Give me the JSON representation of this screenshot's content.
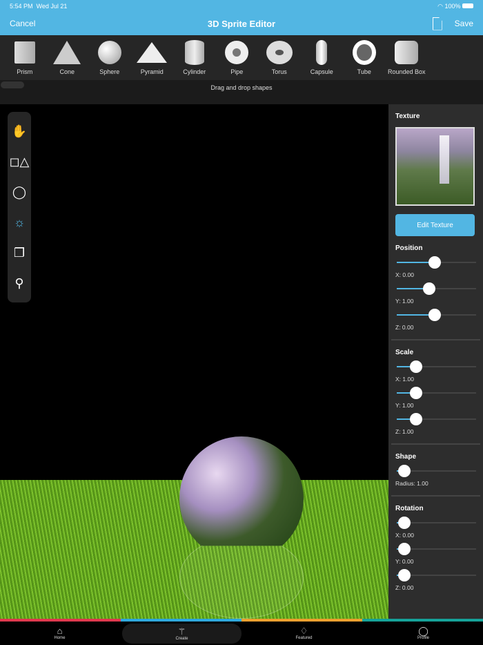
{
  "status": {
    "time": "5:54 PM",
    "date": "Wed Jul 21",
    "battery": "100%"
  },
  "nav": {
    "cancel": "Cancel",
    "title": "3D Sprite Editor",
    "save": "Save"
  },
  "shapes": [
    {
      "label": "Prism"
    },
    {
      "label": "Cone"
    },
    {
      "label": "Sphere"
    },
    {
      "label": "Pyramid"
    },
    {
      "label": "Cylinder"
    },
    {
      "label": "Pipe"
    },
    {
      "label": "Torus"
    },
    {
      "label": "Capsule"
    },
    {
      "label": "Tube"
    },
    {
      "label": "Rounded Box"
    }
  ],
  "drag_hint": "Drag and drop shapes",
  "panel": {
    "texture_title": "Texture",
    "edit_texture": "Edit Texture",
    "position": {
      "title": "Position",
      "x": "X: 0.00",
      "y": "Y: 1.00",
      "z": "Z: 0.00",
      "x_level": 0.5,
      "y_level": 0.42,
      "z_level": 0.5
    },
    "scale": {
      "title": "Scale",
      "x": "X: 1.00",
      "y": "Y: 1.00",
      "z": "Z: 1.00",
      "level": 0.24
    },
    "shape": {
      "title": "Shape",
      "radius": "Radius: 1.00",
      "level": 0.08
    },
    "rotation": {
      "title": "Rotation",
      "x": "X: 0.00",
      "y": "Y: 0.00",
      "z": "Z: 0.00",
      "level": 0.08
    }
  },
  "tabs": [
    {
      "label": "Home"
    },
    {
      "label": "Create"
    },
    {
      "label": "Featured"
    },
    {
      "label": "Profile"
    }
  ],
  "colors": {
    "accent": "#52b6e3",
    "strip": [
      "#e0384f",
      "#2fa8de",
      "#f0a030",
      "#16a39a"
    ]
  }
}
